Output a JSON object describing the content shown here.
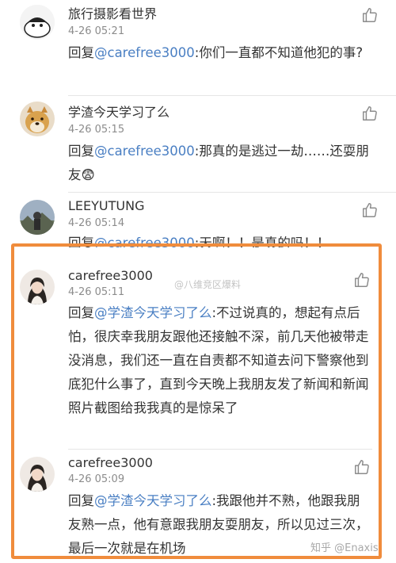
{
  "comments": [
    {
      "name": "旅行摄影看世界",
      "time": "4-26 05:21",
      "reply_prefix": "回复",
      "mention": "@carefree3000",
      "text": ":你们一直都不知道他犯的事?"
    },
    {
      "name": "学渣今天学习了么",
      "time": "4-26 05:15",
      "reply_prefix": "回复",
      "mention": "@carefree3000",
      "text": ":那真的是逃过一劫……还耍朋友😨"
    },
    {
      "name": "LEEYUTUNG",
      "time": "4-26 05:14",
      "reply_prefix": "回复",
      "mention": "@carefree3000",
      "text": ":天啊！！是真的吗！！"
    },
    {
      "name": "carefree3000",
      "time": "4-26 05:11",
      "reply_prefix": "回复",
      "mention": "@学渣今天学习了么",
      "text": ":不过说真的，想起有点后怕，很庆幸我朋友跟他还接触不深，前几天他被带走没消息，我们还一直在自责都不知道去问下警察他到底犯什么事了，直到今天晚上我朋友发了新闻和新闻照片截图给我我真的是惊呆了"
    },
    {
      "name": "carefree3000",
      "time": "4-26 05:09",
      "reply_prefix": "回复",
      "mention": "@学渣今天学习了么",
      "text": ":我跟他并不熟，他跟我朋友熟一点，他有意跟我朋友耍朋友，所以见过三次，最后一次就是在机场"
    }
  ],
  "watermarks": {
    "inline": "@八维竞区爆料",
    "zhihu": "知乎 @Enaxis"
  },
  "icons": {
    "like": "thumbs-up-icon"
  },
  "colors": {
    "mention": "#4a7fc3",
    "highlight_border": "#f08c3c",
    "time": "#8c8c8c"
  }
}
